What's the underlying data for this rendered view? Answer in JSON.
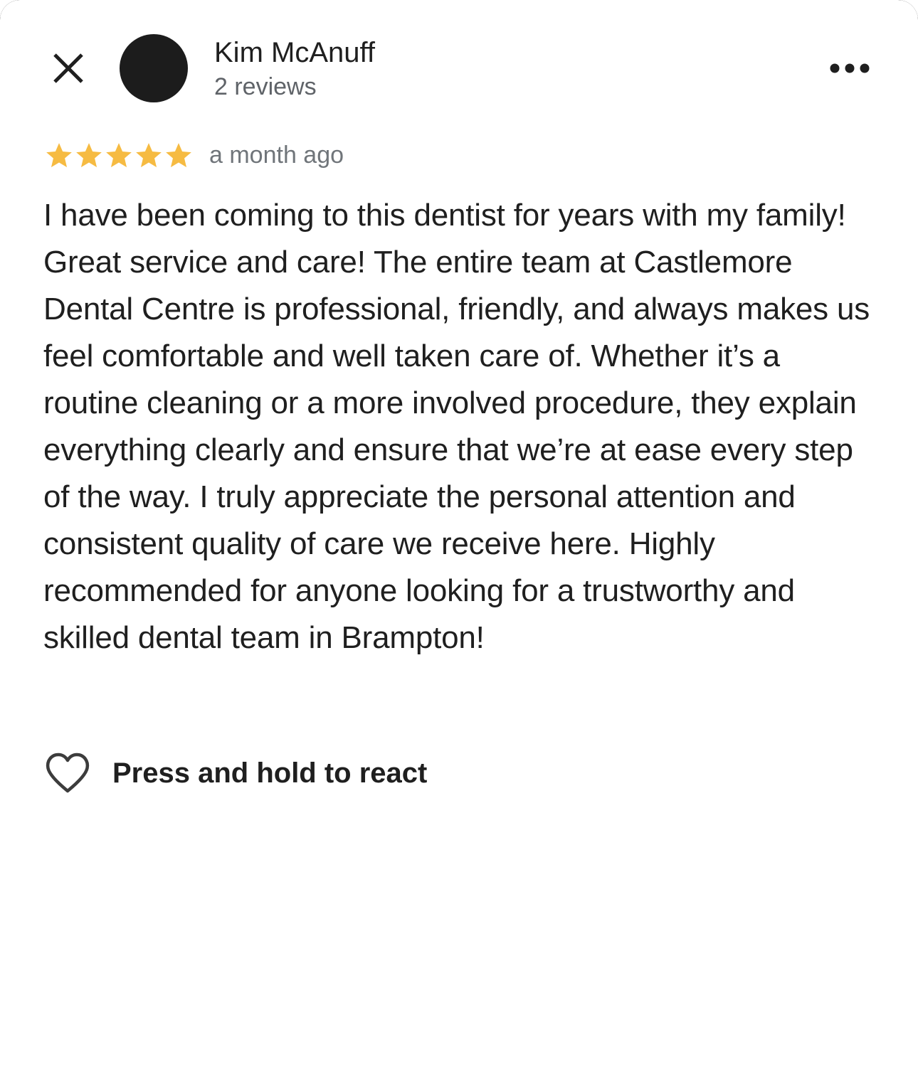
{
  "header": {
    "close_icon": "close-icon",
    "author_name": "Kim McAnuff",
    "author_reviews": "2 reviews",
    "more_icon": "more-horizontal-icon"
  },
  "review": {
    "rating": 5,
    "rating_max": 5,
    "star_color": "#f6bb42",
    "time_ago": "a month ago",
    "text": "I have been coming to this dentist for years with my family! Great service and care! The entire team at Castlemore Dental Centre is professional, friendly, and always makes us feel comfortable and well taken care of. Whether it’s a routine cleaning or a more involved procedure, they explain everything clearly and ensure that we’re at ease every step of the way. I truly appreciate the personal attention and consistent quality of care we receive here. Highly recommended for anyone looking for a trustworthy and skilled dental team in Brampton!"
  },
  "actions": {
    "react_icon": "heart-icon",
    "react_label": "Press and hold to react"
  }
}
